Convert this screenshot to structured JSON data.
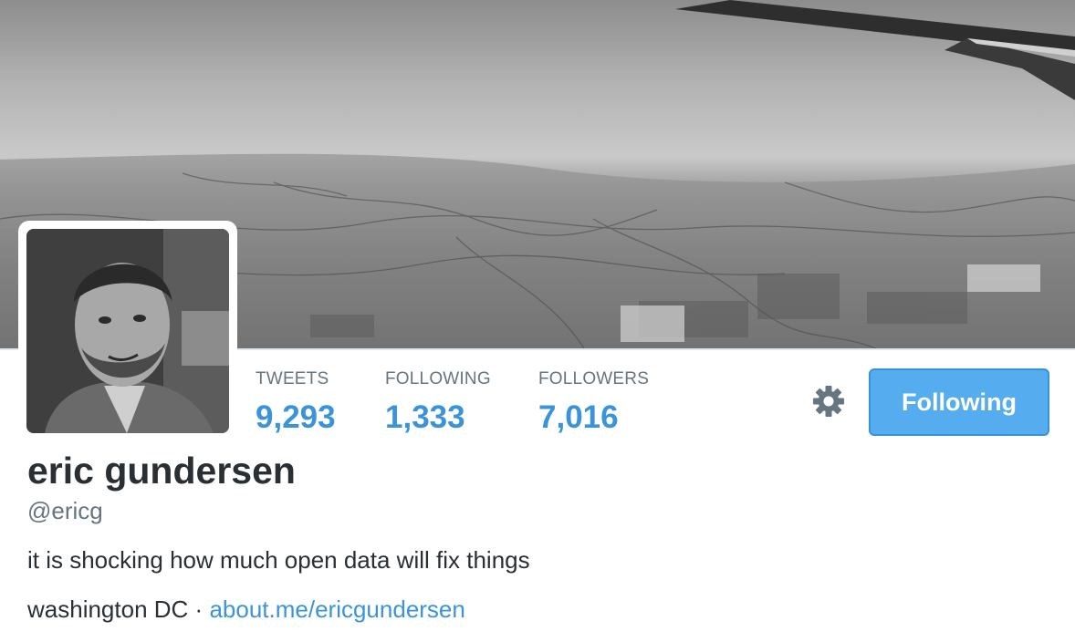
{
  "profile": {
    "name": "eric gundersen",
    "handle": "@ericg",
    "bio": "it is shocking how much open data will fix things",
    "location": "washington DC",
    "separator": "·",
    "website": "about.me/ericgundersen"
  },
  "stats": {
    "tweets": {
      "label": "TWEETS",
      "value": "9,293"
    },
    "following": {
      "label": "FOLLOWING",
      "value": "1,333"
    },
    "followers": {
      "label": "FOLLOWERS",
      "value": "7,016"
    }
  },
  "actions": {
    "follow_button_label": "Following",
    "settings_icon": "gear-icon"
  },
  "colors": {
    "accent": "#3b94d9",
    "button_bg": "#55acee",
    "text_primary": "#292f33",
    "text_secondary": "#66757f"
  }
}
